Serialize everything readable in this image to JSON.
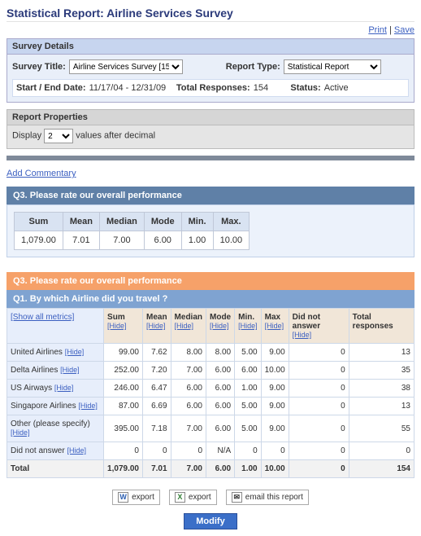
{
  "page": {
    "title": "Statistical Report: Airline Services Survey",
    "links": {
      "print": "Print",
      "save": "Save",
      "sep": " | "
    }
  },
  "survey": {
    "header": "Survey Details",
    "title_lbl": "Survey Title:",
    "title_val": "Airline Services Survey [15",
    "type_lbl": "Report Type:",
    "type_val": "Statistical Report",
    "date_lbl": "Start / End Date:",
    "date_val": "11/17/04 - 12/31/09",
    "resp_lbl": "Total Responses:",
    "resp_val": "154",
    "status_lbl": "Status:",
    "status_val": "Active"
  },
  "props": {
    "header": "Report Properties",
    "display_lbl": "Display",
    "display_val": "2",
    "display_suffix": "values after decimal"
  },
  "addcomm": "Add Commentary",
  "q3": {
    "title": "Q3. Please rate our overall performance",
    "cols": [
      "Sum",
      "Mean",
      "Median",
      "Mode",
      "Min.",
      "Max."
    ],
    "vals": [
      "1,079.00",
      "7.01",
      "7.00",
      "6.00",
      "1.00",
      "10.00"
    ]
  },
  "cross": {
    "title_top": "Q3. Please rate our overall performance",
    "title_sub": "Q1. By which Airline did you travel ?",
    "show_all": "[Show all metrics]",
    "hide_txt": "[Hide]",
    "cols": [
      "Sum",
      "Mean",
      "Median",
      "Mode",
      "Min.",
      "Max",
      "Did not answer",
      "Total responses"
    ],
    "rows": [
      {
        "label": "United Airlines",
        "vals": [
          "99.00",
          "7.62",
          "8.00",
          "8.00",
          "5.00",
          "9.00",
          "0",
          "13"
        ]
      },
      {
        "label": "Delta Airlines",
        "vals": [
          "252.00",
          "7.20",
          "7.00",
          "6.00",
          "6.00",
          "10.00",
          "0",
          "35"
        ]
      },
      {
        "label": "US Airways",
        "vals": [
          "246.00",
          "6.47",
          "6.00",
          "6.00",
          "1.00",
          "9.00",
          "0",
          "38"
        ]
      },
      {
        "label": "Singapore Airlines",
        "vals": [
          "87.00",
          "6.69",
          "6.00",
          "6.00",
          "5.00",
          "9.00",
          "0",
          "13"
        ]
      },
      {
        "label": "Other (please specify)",
        "vals": [
          "395.00",
          "7.18",
          "7.00",
          "6.00",
          "5.00",
          "9.00",
          "0",
          "55"
        ]
      },
      {
        "label": "Did not answer",
        "vals": [
          "0",
          "0",
          "0",
          "N/A",
          "0",
          "0",
          "0",
          "0"
        ]
      },
      {
        "label": "Total",
        "vals": [
          "1,079.00",
          "7.01",
          "7.00",
          "6.00",
          "1.00",
          "10.00",
          "0",
          "154"
        ],
        "total": true
      }
    ]
  },
  "export": {
    "word": "export",
    "excel": "export",
    "email": "email this report",
    "modify": "Modify"
  },
  "chart_data": {
    "type": "table",
    "title": "Q3 overall performance by Q1 airline",
    "columns": [
      "Airline",
      "Sum",
      "Mean",
      "Median",
      "Mode",
      "Min",
      "Max",
      "Did not answer",
      "Total responses"
    ],
    "rows": [
      [
        "United Airlines",
        99.0,
        7.62,
        8.0,
        8.0,
        5.0,
        9.0,
        0,
        13
      ],
      [
        "Delta Airlines",
        252.0,
        7.2,
        7.0,
        6.0,
        6.0,
        10.0,
        0,
        35
      ],
      [
        "US Airways",
        246.0,
        6.47,
        6.0,
        6.0,
        1.0,
        9.0,
        0,
        38
      ],
      [
        "Singapore Airlines",
        87.0,
        6.69,
        6.0,
        6.0,
        5.0,
        9.0,
        0,
        13
      ],
      [
        "Other (please specify)",
        395.0,
        7.18,
        7.0,
        6.0,
        5.0,
        9.0,
        0,
        55
      ],
      [
        "Did not answer",
        0,
        0,
        0,
        null,
        0,
        0,
        0,
        0
      ],
      [
        "Total",
        1079.0,
        7.01,
        7.0,
        6.0,
        1.0,
        10.0,
        0,
        154
      ]
    ]
  }
}
